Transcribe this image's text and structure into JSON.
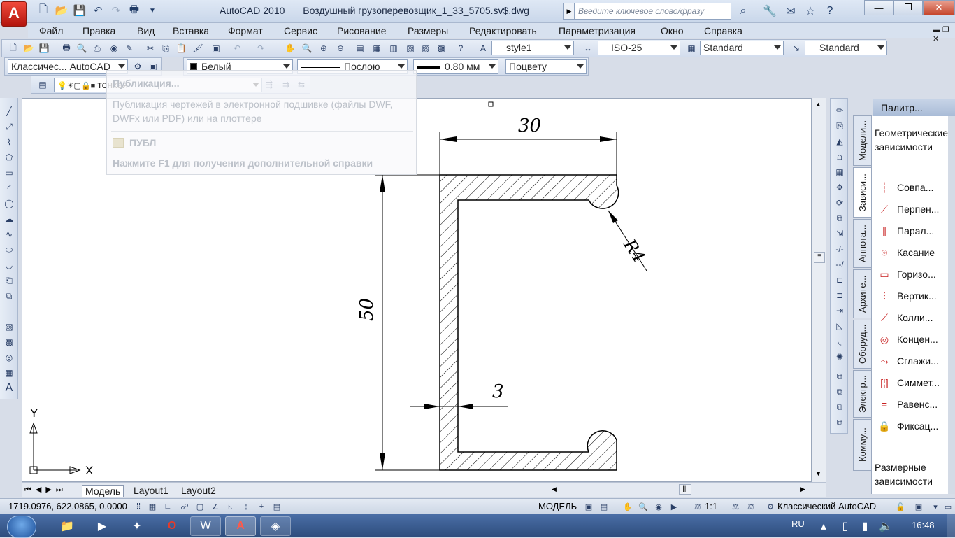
{
  "window": {
    "app_name": "AutoCAD 2010",
    "file_name": "Воздушный грузоперевозщик_1_33_5705.sv$.dwg",
    "search_placeholder": "Введите ключевое слово/фразу",
    "app_logo": "A"
  },
  "menu": [
    "Файл",
    "Правка",
    "Вид",
    "Вставка",
    "Формат",
    "Сервис",
    "Рисование",
    "Размеры",
    "Редактировать",
    "Параметризация",
    "Окно",
    "Справка"
  ],
  "toolbar": {
    "text_style": "style1",
    "dim_style": "ISO-25",
    "table_style": "Standard",
    "multileader_style": "Standard",
    "workspace": "Классичес... AutoCAD",
    "color": "Белый",
    "linetype": "Послою",
    "lineweight": "0.80 мм",
    "plot_style": "Поцвету",
    "layer": "тонкая"
  },
  "tooltip": {
    "title": "Публикация...",
    "description": "Публикация чертежей в электронной подшивке (файлы DWF, DWFx или PDF) или на плоттере",
    "command": "ПУБЛ",
    "help": "Нажмите F1 для получения дополнительной справки"
  },
  "drawing": {
    "dim_width": "30",
    "dim_height": "50",
    "dim_thickness": "3",
    "dim_radius": "R4",
    "ucs_x": "X",
    "ucs_y": "Y"
  },
  "tabs": [
    "Модель",
    "Layout1",
    "Layout2"
  ],
  "palette": {
    "header": "Палитр...",
    "section_title": "Геометрические зависимости",
    "items": [
      "Совпа...",
      "Перпен...",
      "Парал...",
      "Касание",
      "Горизо...",
      "Вертик...",
      "Колли...",
      "Концен...",
      "Сглажи...",
      "Симмет...",
      "Равенс...",
      "Фиксац..."
    ],
    "footer": "Размерные зависимости",
    "tabs": [
      "Модели...",
      "Зависи...",
      "Аннота...",
      "Архите...",
      "Оборуд...",
      "Электр...",
      "Комму..."
    ]
  },
  "status": {
    "coords": "1719.0976, 622.0865, 0.0000",
    "space": "МОДЕЛЬ",
    "scale": "1:1",
    "workspace": "Классический AutoCAD"
  },
  "taskbar": {
    "lang": "RU",
    "time": "16:48"
  }
}
